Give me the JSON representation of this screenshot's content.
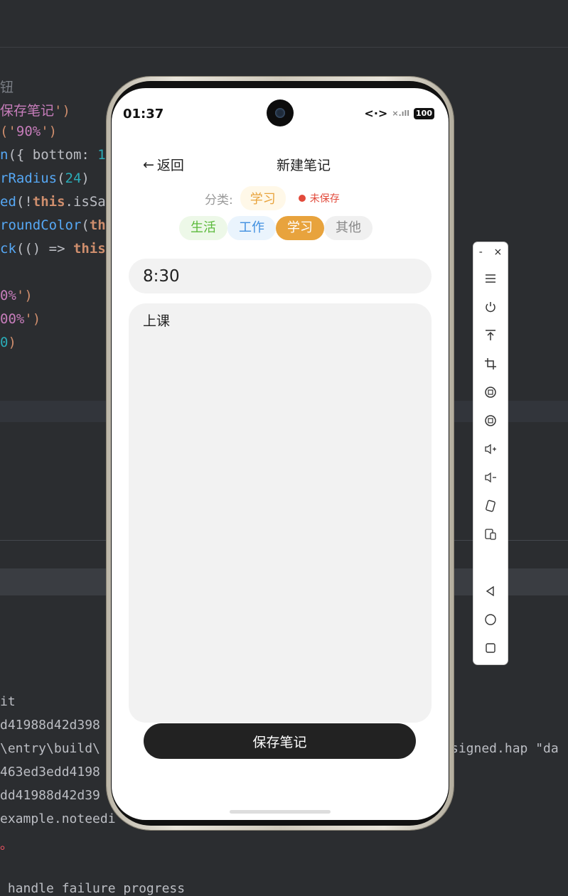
{
  "ide": {
    "code_lines": [
      {
        "parts": [
          {
            "t": "钮",
            "c": "c-gray"
          }
        ]
      },
      {
        "parts": [
          {
            "t": "保存笔记",
            "c": "c-purple"
          },
          {
            "t": "')",
            "c": "c-orange"
          }
        ]
      },
      {
        "parts": [
          {
            "t": "('",
            "c": "c-orange"
          },
          {
            "t": "90%",
            "c": "c-purple"
          },
          {
            "t": "')",
            "c": "c-orange"
          }
        ]
      },
      {
        "parts": [
          {
            "t": "n",
            "c": "c-fn"
          },
          {
            "t": "({ bottom: ",
            "c": ""
          },
          {
            "t": "1",
            "c": "c-num"
          }
        ]
      },
      {
        "parts": [
          {
            "t": "rRadius",
            "c": "c-fn"
          },
          {
            "t": "(",
            "c": ""
          },
          {
            "t": "24",
            "c": "c-num"
          },
          {
            "t": ")",
            "c": ""
          }
        ]
      },
      {
        "parts": [
          {
            "t": "ed",
            "c": "c-fn"
          },
          {
            "t": "(!",
            "c": ""
          },
          {
            "t": "this",
            "c": "c-kw"
          },
          {
            "t": ".isSa",
            "c": ""
          }
        ]
      },
      {
        "parts": [
          {
            "t": "roundColor",
            "c": "c-fn"
          },
          {
            "t": "(",
            "c": ""
          },
          {
            "t": "th",
            "c": "c-kw"
          }
        ]
      },
      {
        "parts": [
          {
            "t": "ck",
            "c": "c-fn"
          },
          {
            "t": "(() => ",
            "c": ""
          },
          {
            "t": "this",
            "c": "c-kw"
          }
        ]
      },
      {
        "parts": [
          {
            "t": "",
            "c": ""
          }
        ]
      },
      {
        "parts": [
          {
            "t": "0%",
            "c": "c-purple"
          },
          {
            "t": "')",
            "c": "c-orange"
          }
        ]
      },
      {
        "parts": [
          {
            "t": "00%",
            "c": "c-purple"
          },
          {
            "t": "')",
            "c": "c-orange"
          }
        ]
      },
      {
        "parts": [
          {
            "t": "0",
            "c": "c-num"
          },
          {
            "t": ")",
            "c": "c-orange"
          }
        ]
      }
    ],
    "console_lines": [
      {
        "text": "it",
        "c": ""
      },
      {
        "text": "d41988d42d398",
        "c": ""
      },
      {
        "text": "\\entry\\build\\",
        "c": ""
      },
      {
        "text": "463ed3edd4198",
        "c": ""
      },
      {
        "text": "dd41988d42d39",
        "c": ""
      },
      {
        "text": "example.noteedi",
        "c": ""
      },
      {
        "text": "。",
        "c": "cons-red"
      },
      {
        "text": "",
        "c": ""
      },
      {
        "text": " handle failure progress",
        "c": ""
      }
    ],
    "console_right": "signed.hap \"da"
  },
  "status_bar": {
    "time": "01:37",
    "network_icon": "<·>",
    "signal": "×.ıll",
    "battery": "100"
  },
  "nav": {
    "back_arrow": "←",
    "back_label": "返回",
    "title": "新建笔记"
  },
  "category": {
    "label": "分类:",
    "current": "学习",
    "status": "未保存"
  },
  "chips": [
    "生活",
    "工作",
    "学习",
    "其他"
  ],
  "form": {
    "title_value": "8:30",
    "content_value": "上课",
    "save_label": "保存笔记"
  },
  "emulator_toolbar": {
    "minimize": "-",
    "close": "×"
  }
}
